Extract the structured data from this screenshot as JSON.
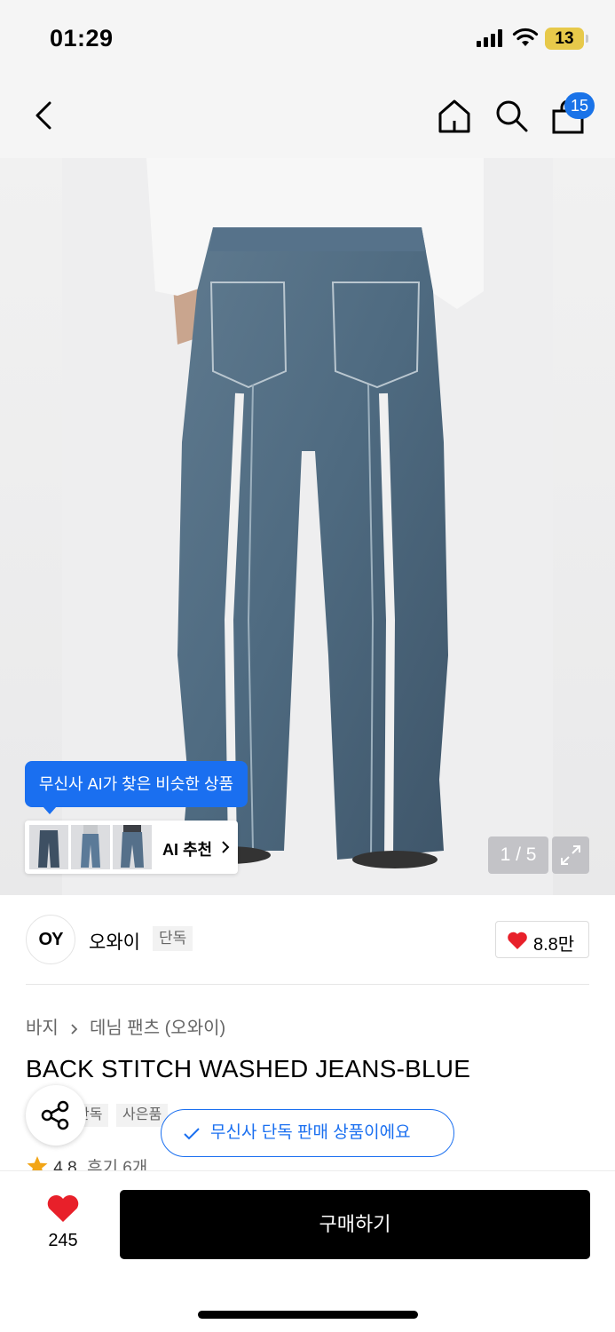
{
  "status_bar": {
    "time": "01:29",
    "battery": "13"
  },
  "nav": {
    "cart_count": "15"
  },
  "image": {
    "ai_tooltip": "무신사 AI가 찾은 비슷한 상품",
    "ai_recommend_label": "AI 추천",
    "page_indicator": "1 / 5"
  },
  "brand": {
    "logo_text": "OY",
    "name": "오와이",
    "tag": "단독",
    "like_count": "8.8만"
  },
  "product": {
    "breadcrumb": [
      "바지",
      "데님 팬츠 (오와이)"
    ],
    "title": "BACK STITCH WASHED JEANS-BLUE",
    "tags": [
      "단독",
      "사은품"
    ],
    "rating": "4.8",
    "review_label": "후기 6개"
  },
  "exclusive_notice": "무신사 단독 판매 상품이에요",
  "bottom": {
    "like_count": "245",
    "buy_label": "구매하기"
  },
  "colors": {
    "accent_blue": "#1a6ff0",
    "heart_red": "#e8202a",
    "battery_yellow": "#e7c94a"
  }
}
